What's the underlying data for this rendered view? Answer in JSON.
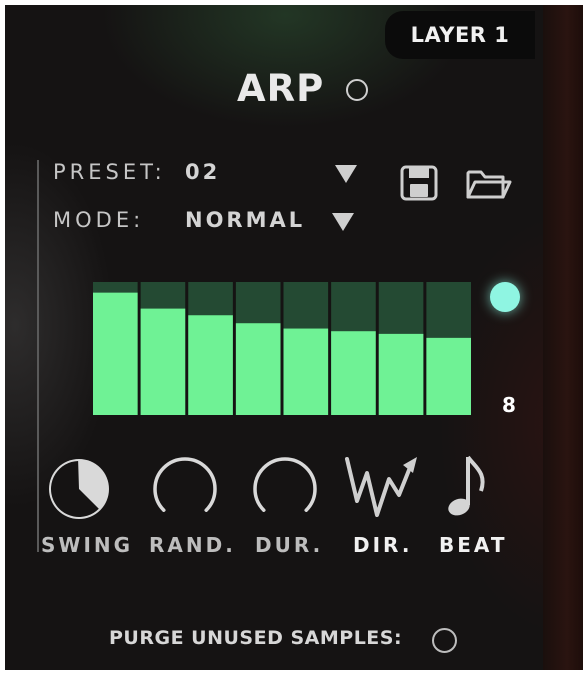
{
  "layer_tab": {
    "label": "LAYER 1"
  },
  "arp": {
    "title": "ARP",
    "enabled": false
  },
  "preset": {
    "label": "PRESET:",
    "value": "02"
  },
  "mode": {
    "label": "MODE:",
    "value": "NORMAL"
  },
  "icons": {
    "save": "save-icon",
    "open": "folder-open-icon",
    "preset_dropdown": "triangle-down-icon",
    "mode_dropdown": "triangle-down-icon",
    "beat": "eighth-note-icon",
    "direction": "zigzag-arrow-icon"
  },
  "steps": {
    "count": "8",
    "levels": [
      0.92,
      0.8,
      0.75,
      0.69,
      0.65,
      0.63,
      0.61,
      0.58
    ],
    "bar_color": "#6ff295",
    "track_color": "#244a33",
    "led_color": "#8ff5e2"
  },
  "controls": [
    {
      "name": "swing",
      "label": "SWING",
      "value": 0.38
    },
    {
      "name": "rand",
      "label": "RAND.",
      "value": 0
    },
    {
      "name": "dur",
      "label": "DUR.",
      "value": 0
    },
    {
      "name": "dir",
      "label": "DIR."
    },
    {
      "name": "beat",
      "label": "BEAT"
    }
  ],
  "purge": {
    "label": "PURGE UNUSED SAMPLES:",
    "enabled": false
  }
}
